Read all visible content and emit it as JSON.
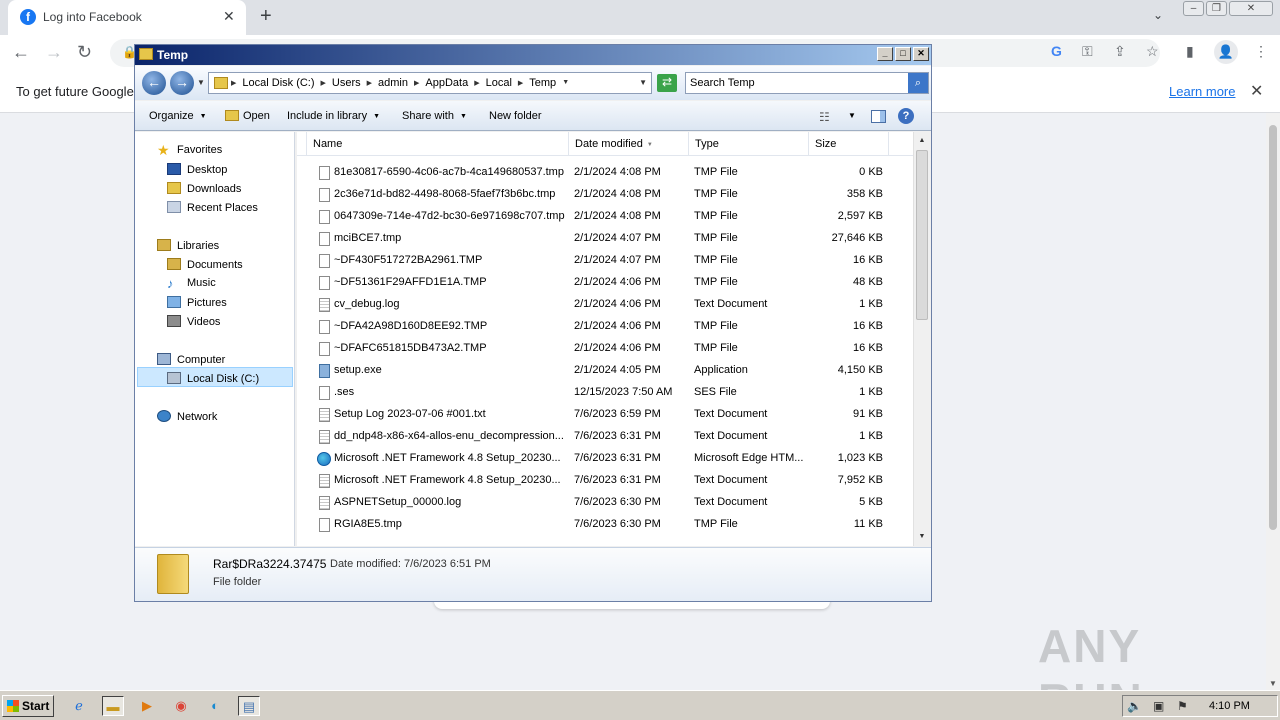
{
  "chrome": {
    "tab_title": "Log into Facebook",
    "tab_close": "✕",
    "new_tab": "+",
    "favicon_letter": "f",
    "infobar_text": "To get future Google",
    "infobar_link": "Learn more",
    "infobar_close": "✕"
  },
  "watermark": "ANY RUN",
  "explorer": {
    "title": "Temp",
    "breadcrumb": [
      "Local Disk (C:)",
      "Users",
      "admin",
      "AppData",
      "Local",
      "Temp"
    ],
    "search_placeholder": "Search Temp",
    "toolbar": {
      "organize": "Organize",
      "open": "Open",
      "include_in_library": "Include in library",
      "share_with": "Share with",
      "new_folder": "New folder"
    },
    "nav": {
      "favorites": "Favorites",
      "desktop": "Desktop",
      "downloads": "Downloads",
      "recent_places": "Recent Places",
      "libraries": "Libraries",
      "documents": "Documents",
      "music": "Music",
      "pictures": "Pictures",
      "videos": "Videos",
      "computer": "Computer",
      "local_disk": "Local Disk (C:)",
      "network": "Network"
    },
    "columns": {
      "name": "Name",
      "date_modified": "Date modified",
      "type": "Type",
      "size": "Size"
    },
    "files": [
      {
        "name": "81e30817-6590-4c06-ac7b-4ca149680537.tmp",
        "date": "2/1/2024 4:08 PM",
        "type": "TMP File",
        "size": "0 KB",
        "icon": "file"
      },
      {
        "name": "2c36e71d-bd82-4498-8068-5faef7f3b6bc.tmp",
        "date": "2/1/2024 4:08 PM",
        "type": "TMP File",
        "size": "358 KB",
        "icon": "file"
      },
      {
        "name": "0647309e-714e-47d2-bc30-6e971698c707.tmp",
        "date": "2/1/2024 4:08 PM",
        "type": "TMP File",
        "size": "2,597 KB",
        "icon": "file"
      },
      {
        "name": "mciBCE7.tmp",
        "date": "2/1/2024 4:07 PM",
        "type": "TMP File",
        "size": "27,646 KB",
        "icon": "file"
      },
      {
        "name": "~DF430F517272BA2961.TMP",
        "date": "2/1/2024 4:07 PM",
        "type": "TMP File",
        "size": "16 KB",
        "icon": "file"
      },
      {
        "name": "~DF51361F29AFFD1E1A.TMP",
        "date": "2/1/2024 4:06 PM",
        "type": "TMP File",
        "size": "48 KB",
        "icon": "file"
      },
      {
        "name": "cv_debug.log",
        "date": "2/1/2024 4:06 PM",
        "type": "Text Document",
        "size": "1 KB",
        "icon": "txt"
      },
      {
        "name": "~DFA42A98D160D8EE92.TMP",
        "date": "2/1/2024 4:06 PM",
        "type": "TMP File",
        "size": "16 KB",
        "icon": "file"
      },
      {
        "name": "~DFAFC651815DB473A2.TMP",
        "date": "2/1/2024 4:06 PM",
        "type": "TMP File",
        "size": "16 KB",
        "icon": "file"
      },
      {
        "name": "setup.exe",
        "date": "2/1/2024 4:05 PM",
        "type": "Application",
        "size": "4,150 KB",
        "icon": "app"
      },
      {
        "name": ".ses",
        "date": "12/15/2023 7:50 AM",
        "type": "SES File",
        "size": "1 KB",
        "icon": "file"
      },
      {
        "name": "Setup Log 2023-07-06 #001.txt",
        "date": "7/6/2023 6:59 PM",
        "type": "Text Document",
        "size": "91 KB",
        "icon": "txt"
      },
      {
        "name": "dd_ndp48-x86-x64-allos-enu_decompression...",
        "date": "7/6/2023 6:31 PM",
        "type": "Text Document",
        "size": "1 KB",
        "icon": "txt"
      },
      {
        "name": "Microsoft .NET Framework 4.8 Setup_20230...",
        "date": "7/6/2023 6:31 PM",
        "type": "Microsoft Edge HTM...",
        "size": "1,023 KB",
        "icon": "edge"
      },
      {
        "name": "Microsoft .NET Framework 4.8 Setup_20230...",
        "date": "7/6/2023 6:31 PM",
        "type": "Text Document",
        "size": "7,952 KB",
        "icon": "txt"
      },
      {
        "name": "ASPNETSetup_00000.log",
        "date": "7/6/2023 6:30 PM",
        "type": "Text Document",
        "size": "5 KB",
        "icon": "txt"
      },
      {
        "name": "RGIA8E5.tmp",
        "date": "7/6/2023 6:30 PM",
        "type": "TMP File",
        "size": "11 KB",
        "icon": "file"
      }
    ],
    "details": {
      "name": "Rar$DRa3224.37475",
      "modified_label": "Date modified: 7/6/2023 6:51 PM",
      "type": "File folder"
    }
  },
  "taskbar": {
    "start": "Start",
    "clock": "4:10 PM"
  }
}
